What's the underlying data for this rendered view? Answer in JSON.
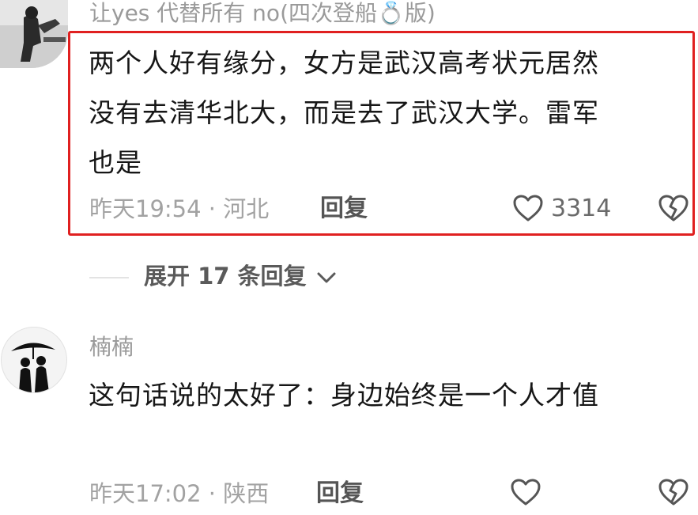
{
  "comments": [
    {
      "username": "让yes 代替所有 no(四次登船💍版)",
      "text_lines": [
        "两个人好有缘分，女方是武汉高考状元居然",
        "没有去清华北大，而是去了武汉大学。雷军",
        "也是"
      ],
      "timestamp": "昨天19:54 · 河北",
      "reply_label": "回复",
      "like_count": "3314",
      "icons": {
        "like": "heart-outline-icon",
        "dislike": "broken-heart-icon"
      }
    },
    {
      "username": "楠楠",
      "text_lines": [
        "这句话说的太好了：身边始终是一个人才值"
      ],
      "timestamp": "昨天17:02 · 陕西",
      "reply_label": "回复",
      "like_count": "",
      "icons": {
        "like": "heart-outline-icon",
        "dislike": "broken-heart-icon"
      }
    }
  ],
  "expand_replies": {
    "label": "展开 17 条回复",
    "icon": "chevron-down-icon"
  },
  "colors": {
    "highlight": "#e02020",
    "muted_text": "#a2a2a2",
    "main_text": "#161616"
  }
}
